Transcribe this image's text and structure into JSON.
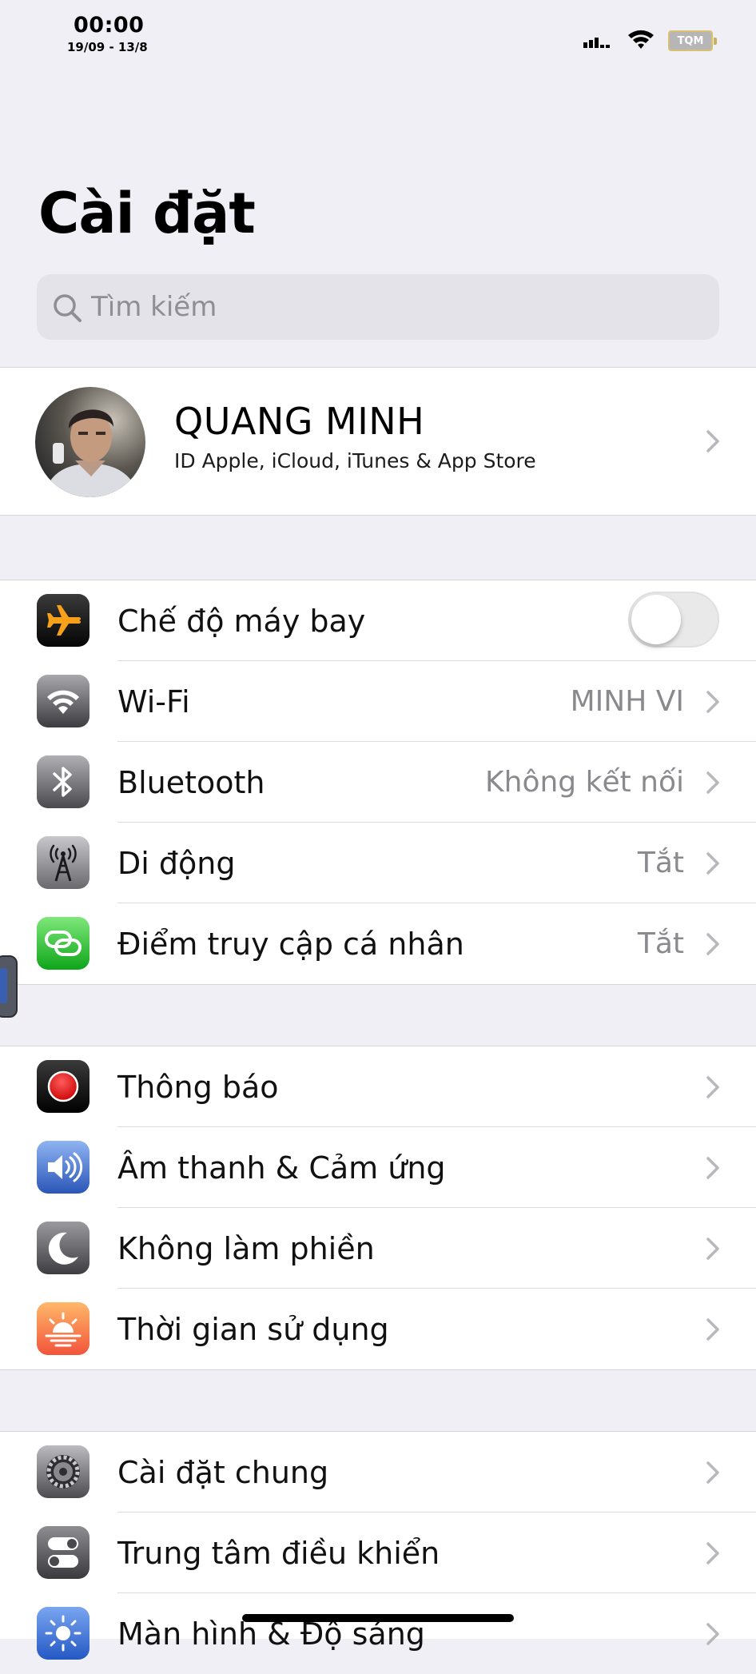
{
  "status": {
    "time": "00:00",
    "date": "19/09 - 13/8",
    "battery_label": "TQM"
  },
  "page": {
    "title": "Cài đặt"
  },
  "search": {
    "placeholder": "Tìm kiếm"
  },
  "profile": {
    "name": "QUANG MINH",
    "subtitle": "ID Apple, iCloud, iTunes & App Store"
  },
  "connectivity": [
    {
      "label": "Chế độ máy bay",
      "value": "",
      "icon": "airplane-icon",
      "toggle": false
    },
    {
      "label": "Wi-Fi",
      "value": "MINH VI",
      "icon": "wifi-icon"
    },
    {
      "label": "Bluetooth",
      "value": "Không kết nối",
      "icon": "bluetooth-icon"
    },
    {
      "label": "Di động",
      "value": "Tắt",
      "icon": "cellular-antenna-icon"
    },
    {
      "label": "Điểm truy cập cá nhân",
      "value": "Tắt",
      "icon": "hotspot-icon"
    }
  ],
  "notifications": [
    {
      "label": "Thông báo",
      "icon": "notifications-icon"
    },
    {
      "label": "Âm thanh & Cảm ứng",
      "icon": "speaker-icon"
    },
    {
      "label": "Không làm phiền",
      "icon": "moon-icon"
    },
    {
      "label": "Thời gian sử dụng",
      "icon": "sunset-icon"
    }
  ],
  "general": [
    {
      "label": "Cài đặt chung",
      "icon": "gear-icon"
    },
    {
      "label": "Trung tâm điều khiển",
      "icon": "switches-icon"
    },
    {
      "label": "Màn hình & Độ sáng",
      "icon": "brightness-icon"
    }
  ]
}
